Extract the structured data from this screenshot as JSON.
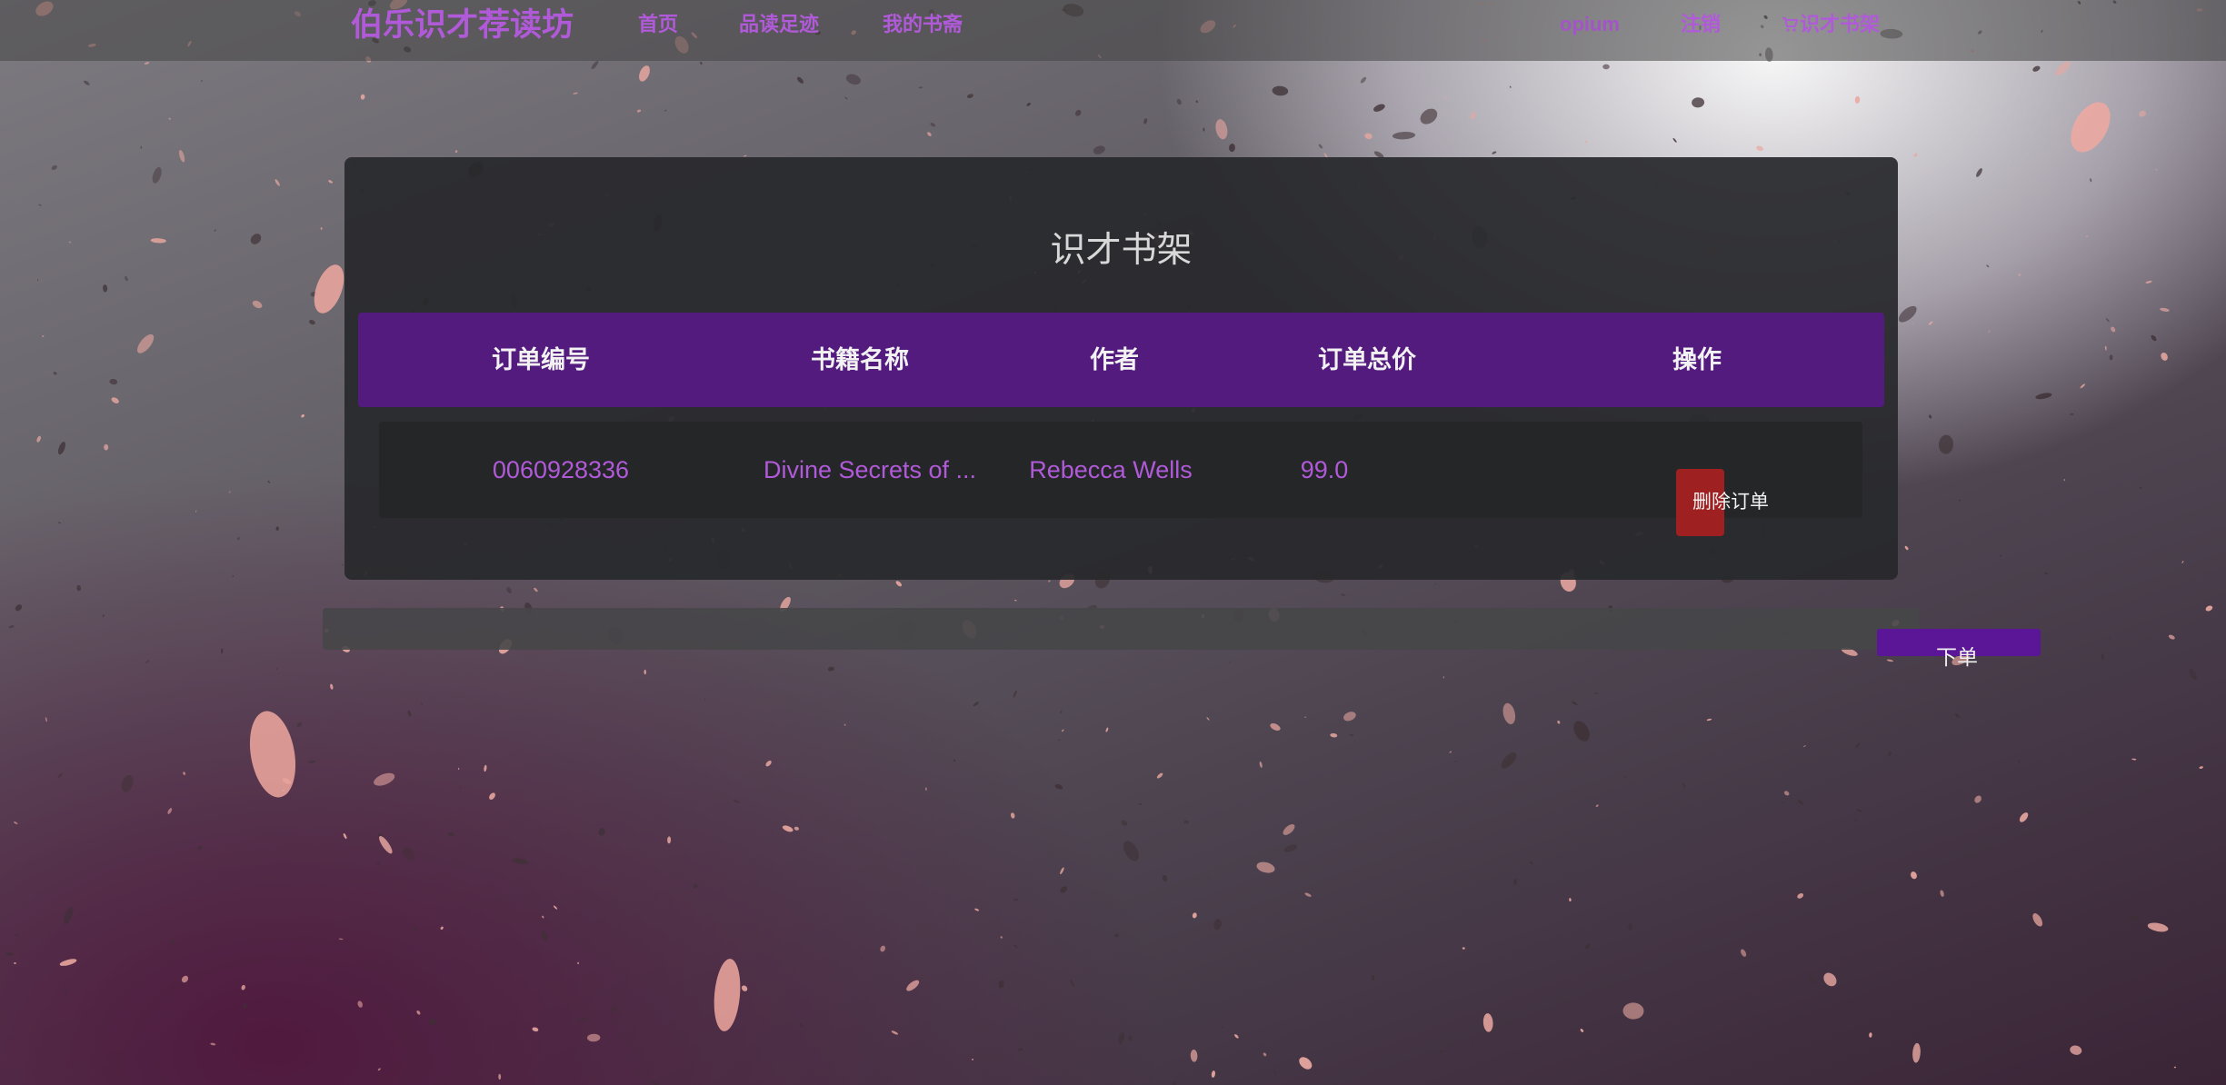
{
  "navbar": {
    "brand": "伯乐识才荐读坊",
    "links": [
      "首页",
      "品读足迹",
      "我的书斋"
    ],
    "user": "opium",
    "logout": "注销",
    "shelf": "识才书架",
    "shelf_icon": "cart-icon"
  },
  "panel": {
    "title": "识才书架",
    "columns": [
      "订单编号",
      "书籍名称",
      "作者",
      "订单总价",
      "操作"
    ],
    "rows": [
      {
        "order_id": "0060928336",
        "book_name": "Divine Secrets of ...",
        "author": "Rebecca Wells",
        "total": "99.0",
        "action": "删除订单"
      }
    ]
  },
  "order_button": "下单",
  "colors": {
    "accent": "#b15ad9",
    "header_bg": "#541b7f",
    "delete_bg": "#9e2020",
    "order_bg": "#5a1696"
  }
}
